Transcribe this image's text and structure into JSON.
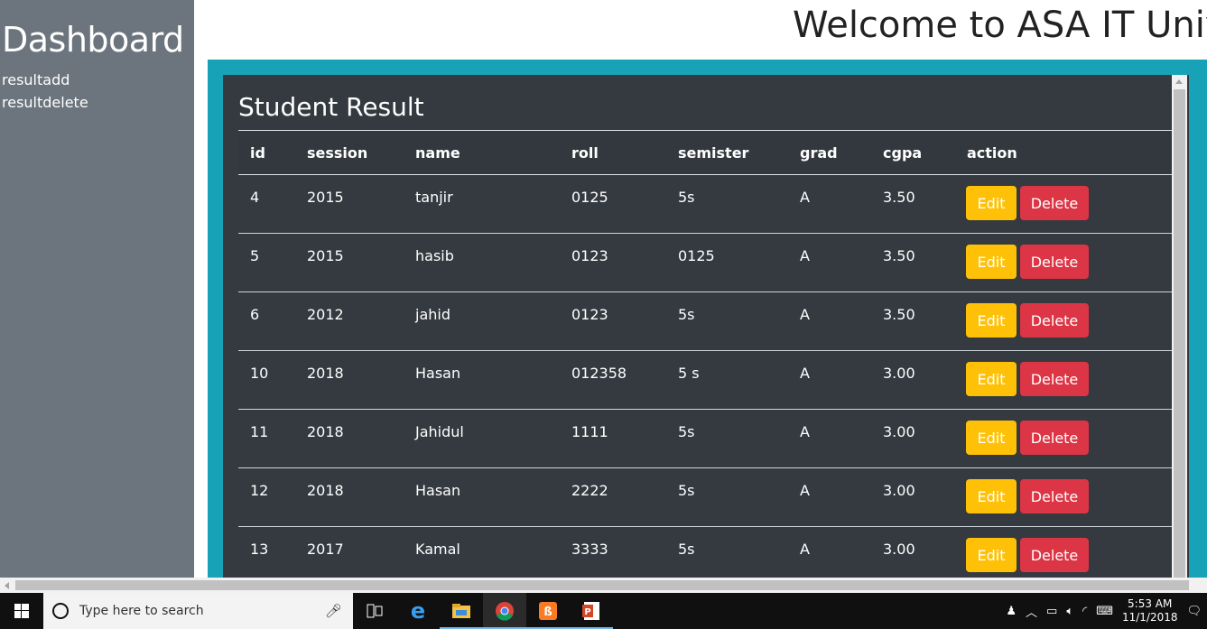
{
  "sidebar": {
    "title": "Dashboard",
    "links": [
      "resultadd",
      "resultdelete"
    ]
  },
  "header": {
    "title": "Welcome to ASA IT University"
  },
  "panel": {
    "title": "Student Result",
    "columns": [
      "id",
      "session",
      "name",
      "roll",
      "semister",
      "grad",
      "cgpa",
      "action"
    ],
    "rows": [
      {
        "id": "4",
        "session": "2015",
        "name": "tanjir",
        "roll": "0125",
        "semister": "5s",
        "grad": "A",
        "cgpa": "3.50"
      },
      {
        "id": "5",
        "session": "2015",
        "name": "hasib",
        "roll": "0123",
        "semister": "0125",
        "grad": "A",
        "cgpa": "3.50"
      },
      {
        "id": "6",
        "session": "2012",
        "name": "jahid",
        "roll": "0123",
        "semister": "5s",
        "grad": "A",
        "cgpa": "3.50"
      },
      {
        "id": "10",
        "session": "2018",
        "name": "Hasan",
        "roll": "012358",
        "semister": "5 s",
        "grad": "A",
        "cgpa": "3.00"
      },
      {
        "id": "11",
        "session": "2018",
        "name": "Jahidul",
        "roll": "1111",
        "semister": "5s",
        "grad": "A",
        "cgpa": "3.00"
      },
      {
        "id": "12",
        "session": "2018",
        "name": "Hasan",
        "roll": "2222",
        "semister": "5s",
        "grad": "A",
        "cgpa": "3.00"
      },
      {
        "id": "13",
        "session": "2017",
        "name": "Kamal",
        "roll": "3333",
        "semister": "5s",
        "grad": "A",
        "cgpa": "3.00"
      }
    ],
    "edit_label": "Edit",
    "delete_label": "Delete"
  },
  "taskbar": {
    "search_placeholder": "Type here to search",
    "time": "5:53 AM",
    "date": "11/1/2018",
    "apps": [
      "task-view-icon",
      "edge-icon",
      "file-explorer-icon",
      "chrome-icon",
      "xampp-icon",
      "powerpoint-icon"
    ]
  },
  "colors": {
    "sidebar": "#6c757d",
    "frame": "#17a2b8",
    "panel": "#343a40",
    "edit": "#ffc107",
    "delete": "#dc3545"
  }
}
